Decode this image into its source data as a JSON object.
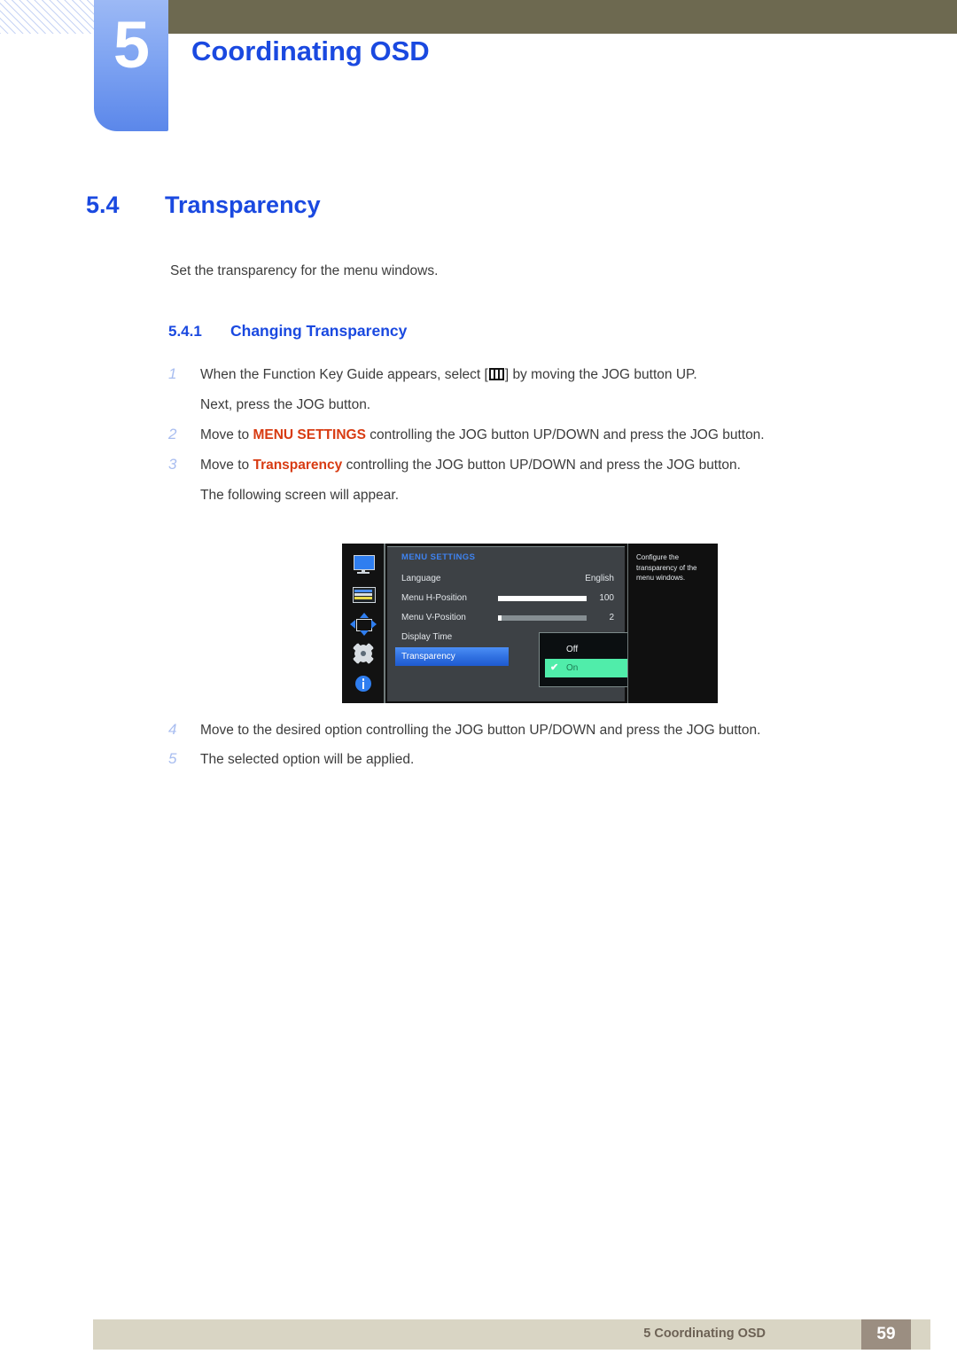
{
  "header": {
    "chapter_number": "5",
    "chapter_title": "Coordinating OSD"
  },
  "section": {
    "number": "5.4",
    "title": "Transparency",
    "intro": "Set the transparency for the menu windows.",
    "subsection_number": "5.4.1",
    "subsection_title": "Changing Transparency"
  },
  "steps": [
    {
      "num": "1",
      "text_before": "When the Function Key Guide appears, select [",
      "icon": "menu-bars-icon",
      "text_after": "] by moving the JOG button UP.",
      "continuation": "Next, press the JOG button."
    },
    {
      "num": "2",
      "text_before": "Move to ",
      "keyword": "MENU SETTINGS",
      "text_after": " controlling the JOG button UP/DOWN and press the JOG button."
    },
    {
      "num": "3",
      "text_before": "Move to ",
      "keyword": "Transparency",
      "text_after": " controlling the JOG button UP/DOWN and press the JOG button.",
      "continuation": "The following screen will appear."
    },
    {
      "num": "4",
      "text_before": "Move to the desired option controlling the JOG button UP/DOWN and press the JOG button."
    },
    {
      "num": "5",
      "text_before": "The selected option will be applied."
    }
  ],
  "osd": {
    "title": "MENU SETTINGS",
    "sidebar_icons": [
      "monitor-icon",
      "picture-settings-icon",
      "position-move-icon",
      "gear-icon",
      "info-icon"
    ],
    "rows": [
      {
        "label": "Language",
        "value": "English",
        "slider": null
      },
      {
        "label": "Menu H-Position",
        "value": "100",
        "slider": 100
      },
      {
        "label": "Menu V-Position",
        "value": "2",
        "slider": 3
      },
      {
        "label": "Display Time",
        "value": "",
        "slider": null
      },
      {
        "label": "Transparency",
        "value": "",
        "slider": null
      }
    ],
    "popup": {
      "options": [
        {
          "label": "Off",
          "selected": false,
          "check": ""
        },
        {
          "label": "On",
          "selected": true,
          "check": "✔"
        }
      ]
    },
    "description": "Configure the transparency of the menu windows."
  },
  "footer": {
    "text": "5 Coordinating OSD",
    "page": "59"
  },
  "colors": {
    "accent_blue": "#1a49e0",
    "keyword_orange": "#d83b12",
    "olive_band": "#6d6950",
    "footer_bar": "#d9d5c4",
    "footer_page_box": "#9b8e81",
    "osd_highlight": "#2f6fe0",
    "osd_selected_option": "#50edaa"
  }
}
